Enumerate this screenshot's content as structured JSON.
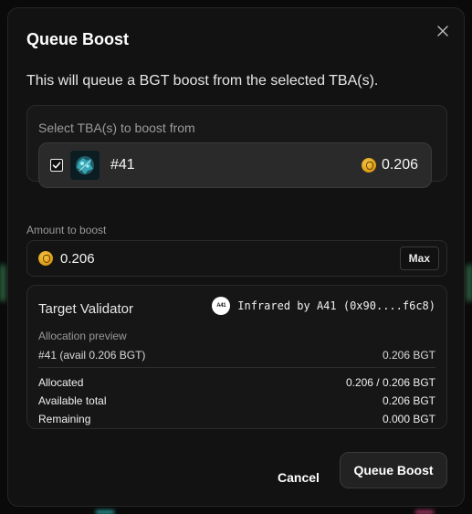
{
  "modal": {
    "title": "Queue Boost",
    "subtitle": "This will queue a BGT boost from the selected TBA(s)."
  },
  "select": {
    "label": "Select TBA(s) to boost from",
    "items": [
      {
        "name": "#41",
        "balance": "0.206",
        "checked": true
      }
    ]
  },
  "amount": {
    "label": "Amount to boost",
    "value": "0.206",
    "max_label": "Max"
  },
  "validator": {
    "title": "Target Validator",
    "logo_text": "A41",
    "name": "Infrared by A41 (0x90....f6c8)",
    "allocation_label": "Allocation preview",
    "rows": [
      {
        "label": "#41 (avail 0.206 BGT)",
        "value": "0.206 BGT"
      },
      {
        "label": "Allocated",
        "value": "0.206 / 0.206 BGT"
      },
      {
        "label": "Available total",
        "value": "0.206 BGT"
      },
      {
        "label": "Remaining",
        "value": "0.000 BGT"
      }
    ]
  },
  "actions": {
    "cancel_label": "Cancel",
    "submit_label": "Queue Boost"
  },
  "colors": {
    "background": "#121212",
    "coin": "#d99a13",
    "text": "#f2f2f2"
  }
}
